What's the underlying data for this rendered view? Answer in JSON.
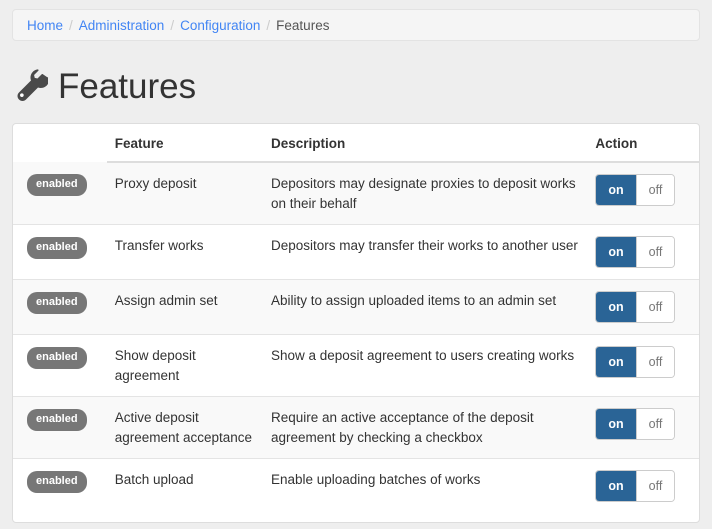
{
  "breadcrumb": {
    "separator": "/",
    "items": [
      {
        "label": "Home",
        "current": false
      },
      {
        "label": "Administration",
        "current": false
      },
      {
        "label": "Configuration",
        "current": false
      },
      {
        "label": "Features",
        "current": true
      }
    ]
  },
  "header": {
    "title": "Features",
    "icon": "wrench-icon"
  },
  "table": {
    "columns": {
      "badge": "",
      "feature": "Feature",
      "description": "Description",
      "action": "Action"
    },
    "rows": [
      {
        "status": "enabled",
        "feature": "Proxy deposit",
        "description": "Depositors may designate proxies to deposit works on their behalf",
        "on_label": "on",
        "off_label": "off",
        "active": "on"
      },
      {
        "status": "enabled",
        "feature": "Transfer works",
        "description": "Depositors may transfer their works to another user",
        "on_label": "on",
        "off_label": "off",
        "active": "on"
      },
      {
        "status": "enabled",
        "feature": "Assign admin set",
        "description": "Ability to assign uploaded items to an admin set",
        "on_label": "on",
        "off_label": "off",
        "active": "on"
      },
      {
        "status": "enabled",
        "feature": "Show deposit agreement",
        "description": "Show a deposit agreement to users creating works",
        "on_label": "on",
        "off_label": "off",
        "active": "on"
      },
      {
        "status": "enabled",
        "feature": "Active deposit agreement acceptance",
        "description": "Require an active acceptance of the deposit agreement by checking a checkbox",
        "on_label": "on",
        "off_label": "off",
        "active": "on"
      },
      {
        "status": "enabled",
        "feature": "Batch upload",
        "description": "Enable uploading batches of works",
        "on_label": "on",
        "off_label": "off",
        "active": "on"
      }
    ]
  },
  "colors": {
    "page_background": "#eeeeee",
    "panel_background": "#ffffff",
    "link": "#4285f4",
    "toggle_active": "#2a6496",
    "badge": "#777777",
    "stripe": "#f9f9f9",
    "border": "#dddddd"
  }
}
